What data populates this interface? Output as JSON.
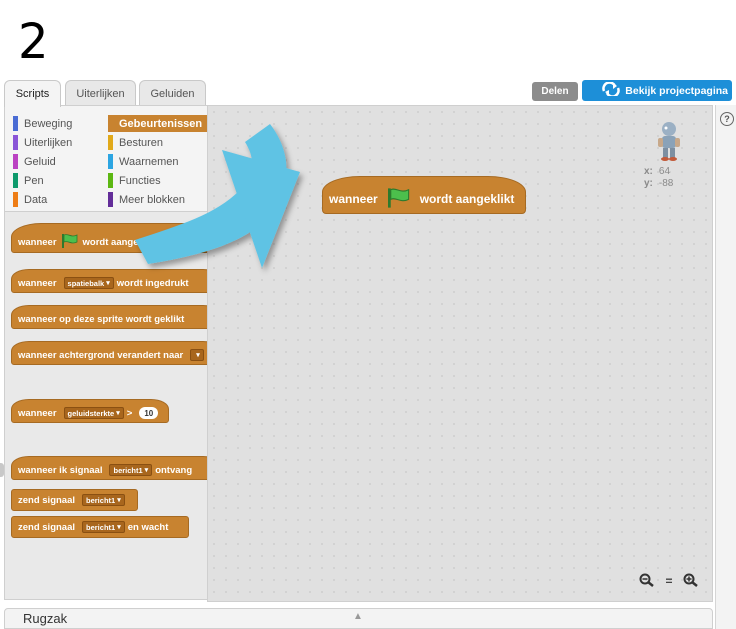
{
  "step_number": "2",
  "tabs": [
    {
      "label": "Scripts",
      "active": true
    },
    {
      "label": "Uiterlijken",
      "active": false
    },
    {
      "label": "Geluiden",
      "active": false
    }
  ],
  "top_buttons": {
    "share": "Delen",
    "project_page": "Bekijk projectpagina"
  },
  "categories": [
    {
      "label": "Beweging",
      "color": "#4a6cd4"
    },
    {
      "label": "Uiterlijken",
      "color": "#8a55d7"
    },
    {
      "label": "Geluid",
      "color": "#bb42c3"
    },
    {
      "label": "Pen",
      "color": "#0e9a6c"
    },
    {
      "label": "Data",
      "color": "#ee7d16"
    },
    {
      "label": "Gebeurtenissen",
      "color": "#c88330",
      "selected": true
    },
    {
      "label": "Besturen",
      "color": "#e1a91a"
    },
    {
      "label": "Waarnemen",
      "color": "#2ca5e2"
    },
    {
      "label": "Functies",
      "color": "#5cb712"
    },
    {
      "label": "Meer blokken",
      "color": "#632d99"
    }
  ],
  "palette_blocks": {
    "flag_when": "wanneer",
    "flag_clicked": "wordt aangeklikt",
    "key_when": "wanneer",
    "key_dropdown": "spatiebalk",
    "key_pressed": "wordt ingedrukt",
    "sprite_clicked": "wanneer op deze sprite wordt geklikt",
    "backdrop_changes": "wanneer achtergrond verandert naar",
    "loudness_when": "wanneer",
    "loudness_dropdown": "geluidsterkte",
    "loudness_gt": ">",
    "loudness_value": "10",
    "receive_when": "wanneer ik signaal",
    "receive_dropdown": "bericht1",
    "receive_label": "ontvang",
    "broadcast_label": "zend signaal",
    "broadcast_dropdown": "bericht1",
    "broadcast_wait_label": "zend signaal",
    "broadcast_wait_dropdown": "bericht1",
    "broadcast_wait_suffix": "en wacht"
  },
  "script_block": {
    "when": "wanneer",
    "clicked": "wordt aangeklikt"
  },
  "sprite_coords": {
    "x_label": "x:",
    "x_value": "64",
    "y_label": "y:",
    "y_value": "-88"
  },
  "zoom": {
    "zoom_out": "−",
    "reset": "=",
    "zoom_in": "+"
  },
  "help_label": "?",
  "backpack_label": "Rugzak",
  "colors": {
    "events_orange": "#c88330",
    "arrow_blue": "#5fc3e4",
    "project_btn_blue": "#1d8fd8",
    "flag_green": "#4cbf4c"
  }
}
